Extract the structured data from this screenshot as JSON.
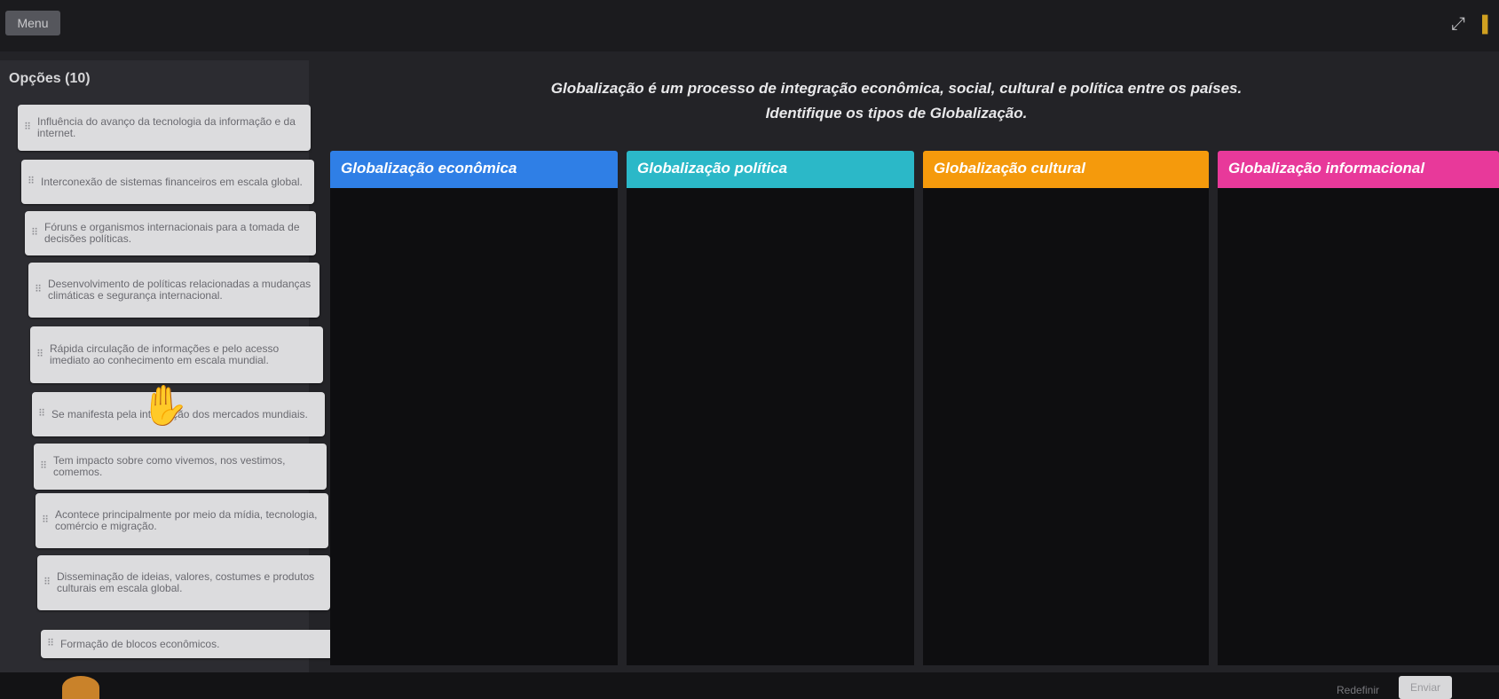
{
  "topbar": {
    "menu_label": "Menu",
    "fullscreen_icon": "fullscreen-icon"
  },
  "options": {
    "title": "Opções (10)",
    "items": [
      "Influência do avanço da tecnologia da informação e da internet.",
      "Interconexão de sistemas financeiros em escala global.",
      "Fóruns e organismos internacionais para a tomada de decisões políticas.",
      "Desenvolvimento de políticas relacionadas a mudanças climáticas e segurança internacional.",
      "Rápida circulação de informações e pelo acesso imediato ao conhecimento em escala mundial.",
      "Se manifesta pela integração dos mercados mundiais.",
      "Tem impacto sobre como vivemos, nos vestimos, comemos.",
      "Acontece principalmente por meio da mídia, tecnologia, comércio e migração.",
      "Disseminação de ideias, valores, costumes e produtos culturais em escala global.",
      "Formação de blocos econômicos."
    ]
  },
  "instructions": {
    "line1": "Globalização é um processo de integração econômica, social, cultural e política entre os países.",
    "line2": "Identifique os tipos de Globalização."
  },
  "columns": [
    {
      "label": "Globalização econômica",
      "color": "#2f7fe6"
    },
    {
      "label": "Globalização política",
      "color": "#2bb8c8"
    },
    {
      "label": "Globalização cultural",
      "color": "#f59a0c"
    },
    {
      "label": "Globalização informacional",
      "color": "#e8399a"
    }
  ],
  "footer": {
    "reset_label": "Redefinir",
    "send_label": "Enviar"
  }
}
